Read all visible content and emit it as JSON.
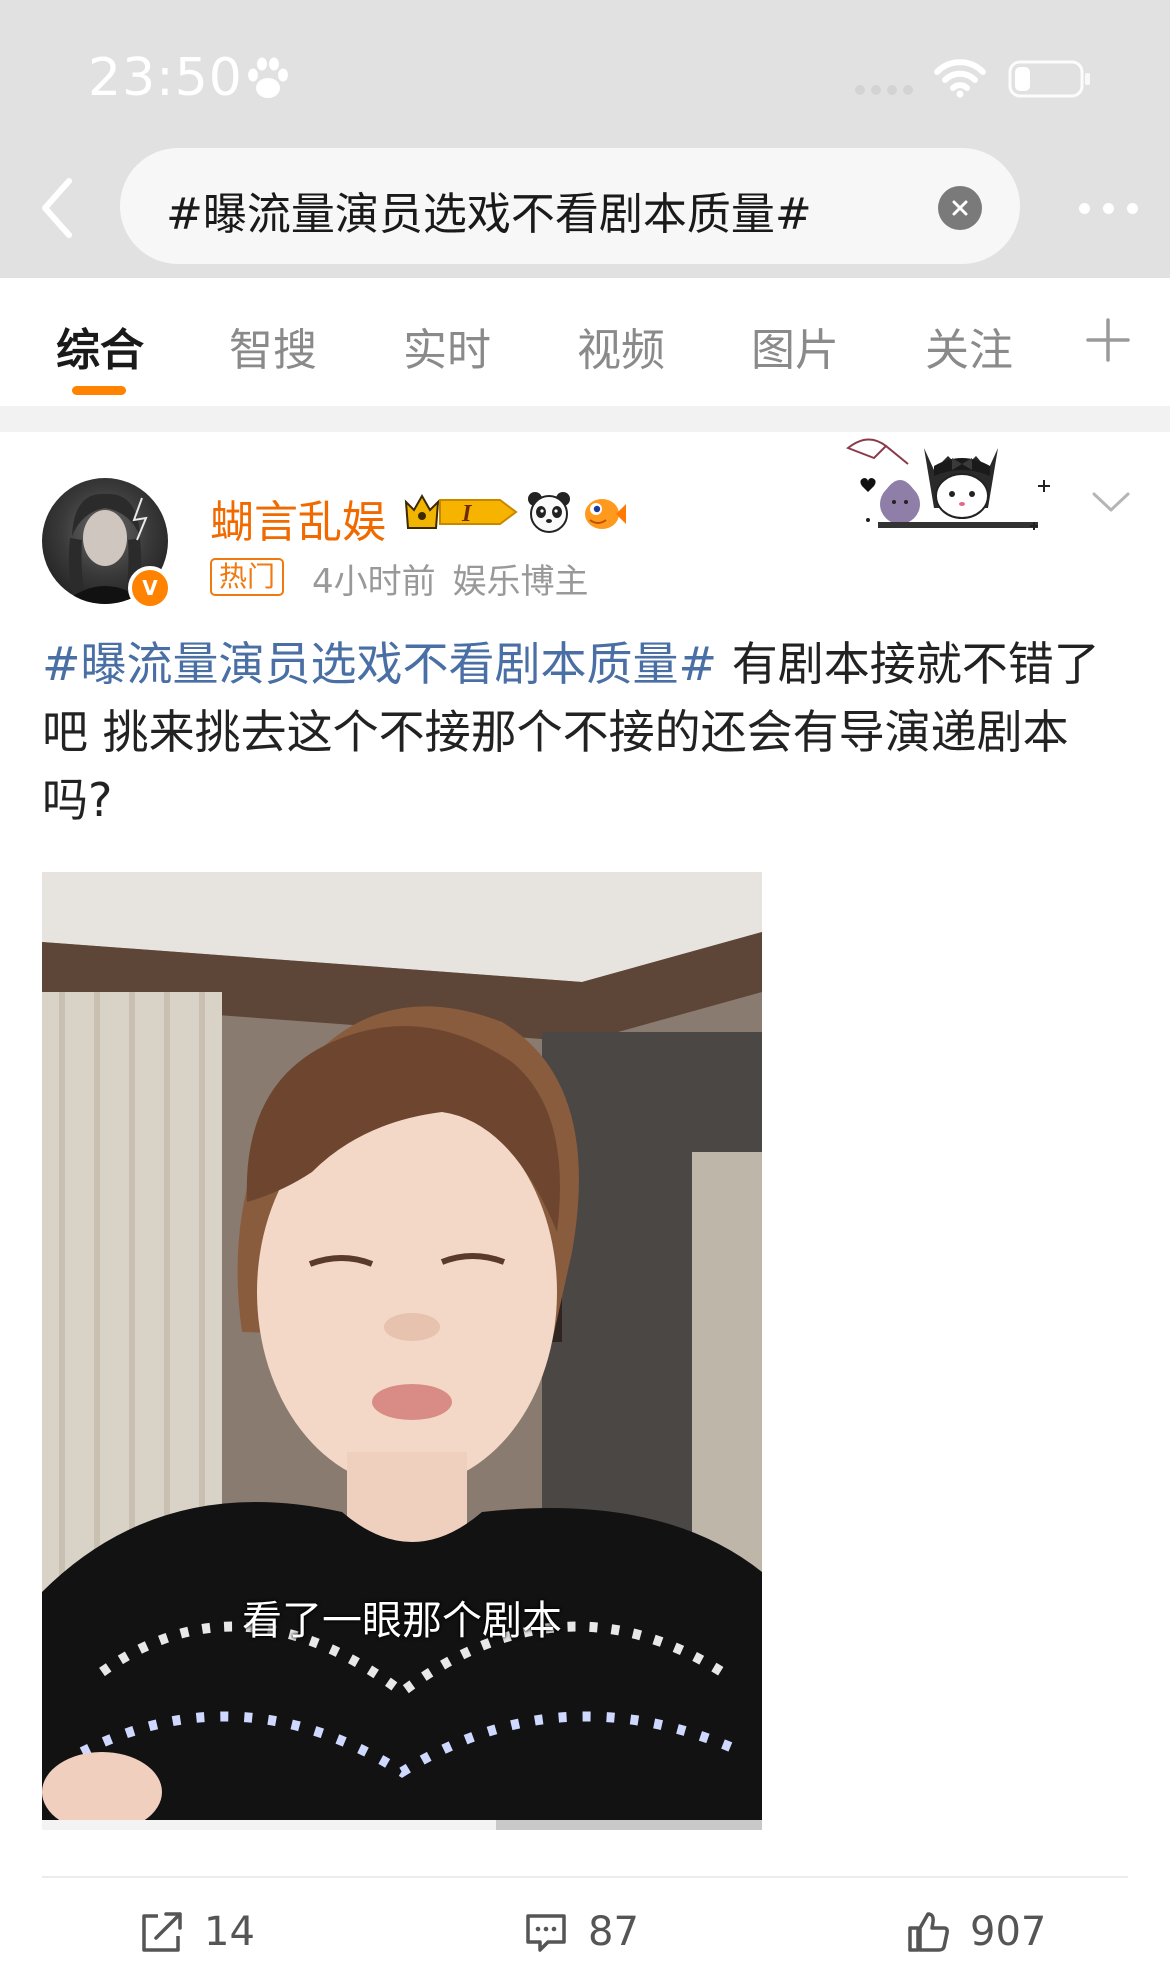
{
  "status_bar": {
    "time": "23:50",
    "icons": [
      "paw-icon",
      "signal-dots-icon",
      "wifi-icon",
      "battery-icon"
    ]
  },
  "header": {
    "back_icon": "chevron-left-icon",
    "search_query": "#曝流量演员选戏不看剧本质量#",
    "clear_icon": "clear-icon",
    "more_icon": "more-dots-icon"
  },
  "tabs": [
    {
      "label": "综合",
      "active": true
    },
    {
      "label": "智搜",
      "active": false
    },
    {
      "label": "实时",
      "active": false
    },
    {
      "label": "视频",
      "active": false
    },
    {
      "label": "图片",
      "active": false
    },
    {
      "label": "关注",
      "active": false
    }
  ],
  "tab_add_icon": "plus-icon",
  "post": {
    "author": {
      "name": "蝴言乱娱",
      "verified_icon": "v-icon",
      "verified_text": "V",
      "badges": [
        "crown-member-badge-icon",
        "panda-icon",
        "fish-icon"
      ],
      "member_badge_text": "I"
    },
    "hot_tag": "热门",
    "time_ago": "4小时前",
    "source": "娱乐博主",
    "topic": "#曝流量演员选戏不看剧本质量#",
    "body": " 有剧本接就不错了吧 挑来挑去这个不接那个不接的还会有导演递剧本吗?",
    "video": {
      "subtitle": "看了一眼那个剧本",
      "progress": 0.63
    },
    "actions": {
      "repost": {
        "icon": "repost-icon",
        "count": "14"
      },
      "comment": {
        "icon": "comment-icon",
        "count": "87"
      },
      "like": {
        "icon": "like-icon",
        "count": "907"
      }
    }
  },
  "colors": {
    "accent": "#ff8200",
    "author_name": "#f06a00",
    "topic_link": "#4a6fa5",
    "header_bg": "#e1e1e1"
  }
}
